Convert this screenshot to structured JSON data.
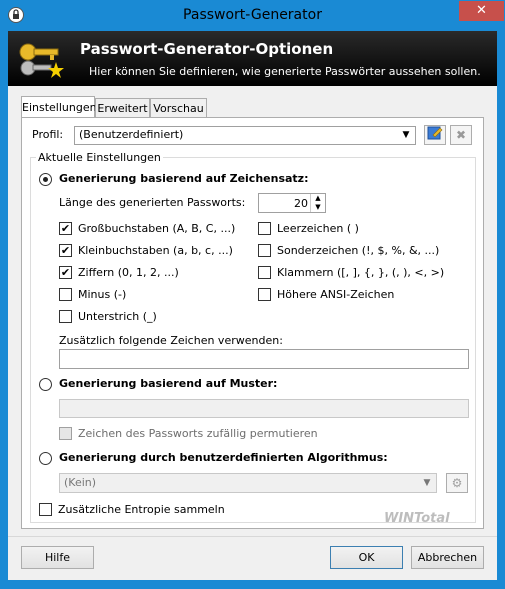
{
  "window": {
    "title": "Passwort-Generator",
    "close": "✕"
  },
  "banner": {
    "title": "Passwort-Generator-Optionen",
    "subtitle": "Hier können Sie definieren, wie generierte Passwörter aussehen sollen."
  },
  "tabs": [
    {
      "label": "Einstellungen",
      "active": true
    },
    {
      "label": "Erweitert",
      "active": false
    },
    {
      "label": "Vorschau",
      "active": false
    }
  ],
  "profile": {
    "label": "Profil:",
    "value": "(Benutzerdefiniert)"
  },
  "group_current": {
    "label": "Aktuelle Einstellungen"
  },
  "charset_mode": {
    "label": "Generierung basierend auf Zeichensatz:",
    "selected": true,
    "length_label": "Länge des generierten Passworts:",
    "length_value": "20",
    "options": [
      {
        "label": "Großbuchstaben (A, B, C, ...)",
        "checked": true
      },
      {
        "label": "Kleinbuchstaben (a, b, c, ...)",
        "checked": true
      },
      {
        "label": "Ziffern (0, 1, 2, ...)",
        "checked": true
      },
      {
        "label": "Minus (-)",
        "checked": false
      },
      {
        "label": "Unterstrich (_)",
        "checked": false
      },
      {
        "label": "Leerzeichen ( )",
        "checked": false
      },
      {
        "label": "Sonderzeichen (!, $, %, &, ...)",
        "checked": false
      },
      {
        "label": "Klammern ([, ], {, }, (, ), <, >)",
        "checked": false
      },
      {
        "label": "Höhere ANSI-Zeichen",
        "checked": false
      }
    ],
    "extra_label": "Zusätzlich folgende Zeichen verwenden:",
    "extra_value": ""
  },
  "pattern_mode": {
    "label": "Generierung basierend auf Muster:",
    "selected": false,
    "value": "",
    "permute_label": "Zeichen des Passworts zufällig permutieren",
    "permute_checked": false
  },
  "algorithm_mode": {
    "label": "Generierung durch benutzerdefinierten Algorithmus:",
    "selected": false,
    "value": "(Kein)"
  },
  "entropy": {
    "label": "Zusätzliche Entropie sammeln",
    "checked": false
  },
  "watermark": "WINTotal",
  "buttons": {
    "help": "Hilfe",
    "ok": "OK",
    "cancel": "Abbrechen"
  },
  "icons": {
    "app": "lock-icon",
    "banner": "keys-icon",
    "save": "save-profile-icon",
    "delete": "delete-profile-icon",
    "settings": "gear-icon"
  }
}
